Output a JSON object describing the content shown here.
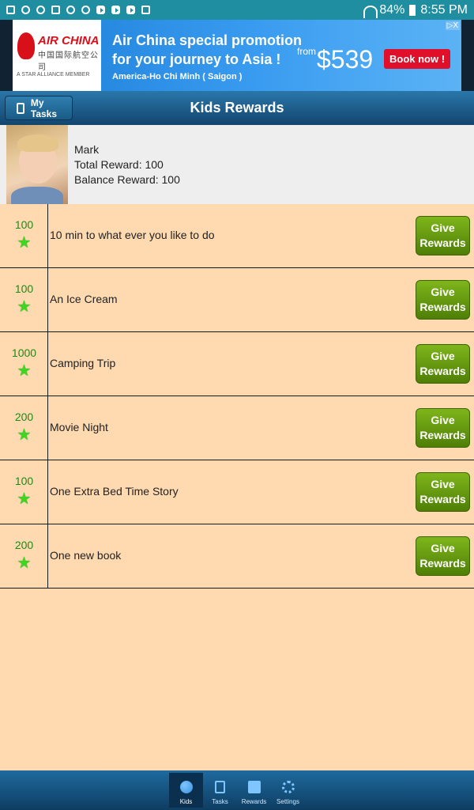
{
  "status_bar": {
    "battery": "84%",
    "time": "8:55 PM"
  },
  "ad": {
    "brand": "AIR CHINA",
    "brand_chinese": "中国国际航空公司",
    "alliance": "A STAR ALLIANCE MEMBER",
    "title_line1": "Air China special promotion",
    "title_line2": "for your journey to Asia !",
    "route": "America-Ho Chi Minh ( Saigon )",
    "from_label": "from",
    "price": "$539",
    "cta": "Book now !",
    "close": "▷X"
  },
  "header": {
    "back_label": "My Tasks",
    "title": "Kids Rewards"
  },
  "profile": {
    "name": "Mark",
    "total_reward": "Total Reward: 100",
    "balance_reward": "Balance Reward: 100"
  },
  "rewards": [
    {
      "points": "100",
      "title": "10 min to what ever you like to do",
      "button": "Give Rewards"
    },
    {
      "points": "100",
      "title": "An Ice Cream",
      "button": "Give Rewards"
    },
    {
      "points": "1000",
      "title": "Camping Trip",
      "button": "Give Rewards"
    },
    {
      "points": "200",
      "title": "Movie Night",
      "button": "Give Rewards"
    },
    {
      "points": "100",
      "title": "One Extra Bed Time Story",
      "button": "Give Rewards"
    },
    {
      "points": "200",
      "title": "One new book",
      "button": "Give Rewards"
    }
  ],
  "bottom_nav": {
    "items": [
      {
        "label": "Kids",
        "icon": "kids-icon",
        "active": true
      },
      {
        "label": "Tasks",
        "icon": "tasks-icon",
        "active": false
      },
      {
        "label": "Rewards",
        "icon": "rewards-icon",
        "active": false
      },
      {
        "label": "Settings",
        "icon": "settings-icon",
        "active": false
      }
    ]
  },
  "colors": {
    "background": "#ffd9b0",
    "header": "#13456e",
    "give_button": "#6b9c11",
    "points": "#1f8a16",
    "star": "#3bd81f"
  }
}
